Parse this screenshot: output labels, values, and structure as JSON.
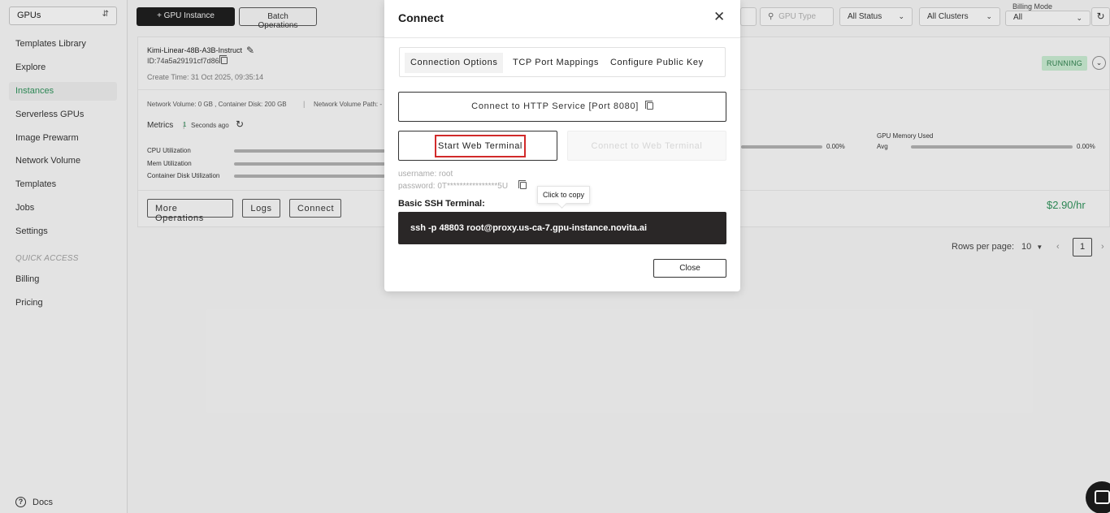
{
  "sidebar": {
    "product_select": "GPUs",
    "items": [
      {
        "label": "Templates Library"
      },
      {
        "label": "Explore"
      },
      {
        "label": "Instances"
      },
      {
        "label": "Serverless GPUs"
      },
      {
        "label": "Image Prewarm"
      },
      {
        "label": "Network Volume"
      },
      {
        "label": "Templates"
      },
      {
        "label": "Jobs"
      },
      {
        "label": "Settings"
      }
    ],
    "quick_access_label": "QUICK ACCESS",
    "quick_items": [
      {
        "label": "Billing"
      },
      {
        "label": "Pricing"
      }
    ],
    "docs_label": "Docs"
  },
  "toolbar": {
    "add_gpu_label": "+ GPU Instance",
    "batch_label": "Batch Operations",
    "gpu_type_placeholder": "GPU Type",
    "status_filter": "All Status",
    "cluster_filter": "All Clusters",
    "billing_mode_label": "Billing Mode",
    "billing_mode_value": "All"
  },
  "instance": {
    "name": "Kimi-Linear-48B-A3B-Instruct",
    "id": "ID:74a5a29191cf7d86",
    "create_time": "Create Time: 31 Oct 2025, 09:35:14",
    "volume_info": "Network Volume: 0 GB , Container Disk: 200 GB",
    "volume_path": "Network Volume Path: -",
    "status": "RUNNING",
    "metrics_label": "Metrics",
    "metrics_interval": "1",
    "metrics_ago": "Seconds ago",
    "cpu_label": "CPU Utilization",
    "mem_label": "Mem Utilization",
    "disk_label": "Container Disk Utilization",
    "gpu_util_value": "0.00%",
    "gpu_mem_label": "GPU Memory Used",
    "gpu_mem_avg_label": "Avg",
    "gpu_mem_value": "0.00%",
    "more_ops_label": "More Operations",
    "logs_label": "Logs",
    "connect_label": "Connect",
    "price": "$2.90/hr"
  },
  "pagination": {
    "rows_per_page_label": "Rows per page:",
    "rows_per_page": "10",
    "current_page": "1"
  },
  "modal": {
    "title": "Connect",
    "tabs": [
      {
        "label": "Connection Options"
      },
      {
        "label": "TCP Port Mappings"
      },
      {
        "label": "Configure Public Key"
      }
    ],
    "http_button": "Connect to HTTP Service [Port 8080]",
    "start_terminal": "Start Web Terminal",
    "connect_terminal": "Connect to Web Terminal",
    "username_line": "username: root",
    "password_line": "password: 0T****************5U",
    "tooltip": "Click to copy",
    "ssh_title": "Basic SSH Terminal:",
    "ssh_command": "ssh -p 48803 root@proxy.us-ca-7.gpu-instance.novita.ai",
    "close_label": "Close"
  }
}
